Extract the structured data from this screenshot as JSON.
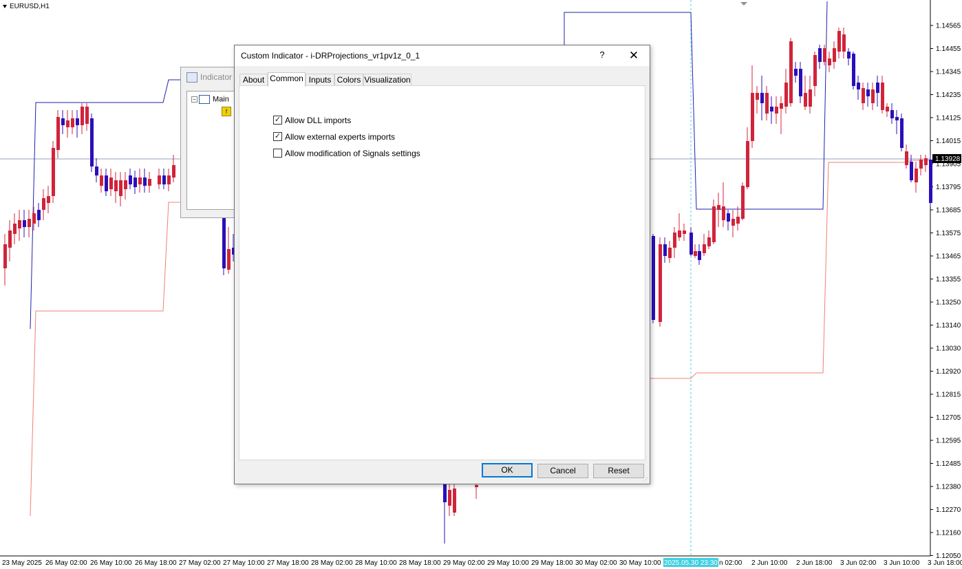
{
  "chart": {
    "symbol": "EURUSD,H1",
    "current_price": "1.13928",
    "cursor_time": "2025.05.30 23:30",
    "price_labels": [
      "1.14565",
      "1.14455",
      "1.14345",
      "1.14235",
      "1.14125",
      "1.14015",
      "1.13905",
      "1.13795",
      "1.13685",
      "1.13575",
      "1.13465",
      "1.13355",
      "1.13250",
      "1.13140",
      "1.13030",
      "1.12920",
      "1.12815",
      "1.12705",
      "1.12595",
      "1.12485",
      "1.12380",
      "1.12270",
      "1.12160",
      "1.12050"
    ],
    "time_labels": [
      "23 May 2025",
      "26 May 02:00",
      "26 May 10:00",
      "26 May 18:00",
      "27 May 02:00",
      "27 May 10:00",
      "27 May 18:00",
      "28 May 02:00",
      "28 May 10:00",
      "28 May 18:00",
      "29 May 02:00",
      "29 May 10:00",
      "29 May 18:00",
      "30 May 02:00",
      "30 May 10:00",
      "2025.05.30 23:30",
      "n 02:00",
      "2 Jun 10:00",
      "2 Jun 18:00",
      "3 Jun 02:00",
      "3 Jun 10:00",
      "3 Jun 18:00"
    ],
    "colors": {
      "bull": "#d0243a",
      "bear": "#2a0fb8",
      "upper_line": "#1f1fb0",
      "lower_line": "#f08070",
      "cursor_line": "#40d0e0",
      "cursor_label_bg": "#40d0e0",
      "price_label_bg": "#000000"
    }
  },
  "background_dialog": {
    "title": "Indicator",
    "tree_root": "Main"
  },
  "dialog": {
    "title": "Custom Indicator - i-DRProjections_vr1pv1z_0_1",
    "help": "?",
    "close": "✕",
    "tabs": [
      {
        "label": "About",
        "active": false
      },
      {
        "label": "Common",
        "active": true
      },
      {
        "label": "Inputs",
        "active": false
      },
      {
        "label": "Colors",
        "active": false
      },
      {
        "label": "Visualization",
        "active": false
      }
    ],
    "options": [
      {
        "label": "Allow DLL imports",
        "checked": true
      },
      {
        "label": "Allow external experts imports",
        "checked": true
      },
      {
        "label": "Allow modification of Signals settings",
        "checked": false
      }
    ],
    "buttons": {
      "ok": "OK",
      "cancel": "Cancel",
      "reset": "Reset"
    }
  }
}
